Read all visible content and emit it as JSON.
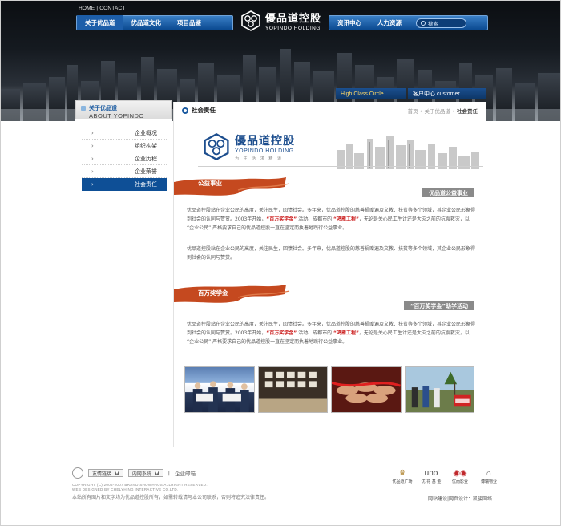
{
  "topnav": {
    "home": "HOME",
    "sep": "|",
    "contact": "CONTACT"
  },
  "nav_left": [
    "关于优品道",
    "优品道文化",
    "项目品鉴"
  ],
  "nav_right": [
    "资讯中心",
    "人力资源"
  ],
  "search": {
    "placeholder": "搜索"
  },
  "logo": {
    "cn": "優品道控股",
    "en": "YOPINDO HOLDING"
  },
  "tabs": {
    "high_class": "High Class Circle",
    "customer": "客户中心 customer"
  },
  "sidebar": {
    "heading_cn": "关于优品道",
    "heading_en": "ABOUT YOPINDO",
    "items": [
      {
        "label": "企业概况"
      },
      {
        "label": "组织构架"
      },
      {
        "label": "企业历程"
      },
      {
        "label": "企业荣誉"
      },
      {
        "label": "社会责任",
        "active": true
      }
    ]
  },
  "main": {
    "title": "社会责任",
    "breadcrumb": {
      "home": "首页",
      "sep1": " • ",
      "parent": "关于优品道",
      "sep2": " • ",
      "current": "社会责任"
    },
    "banner": {
      "cn": "優品道控股",
      "en": "YOPINDO HOLDING",
      "slogan": "为 生 活 求 精 道"
    },
    "section1": {
      "ribbon": "公益事业",
      "tab": "优品道公益事业",
      "p1_a": "优品道控股站在企业公民的高度，关注民生，回馈社会。多年来，优品道控股的慈善捐赠遍及文教、扶贫等多个领域，其企业公民形象得到社会的认同与赞赏。2003年开始，",
      "p1_hl1": "“百万奖学金”",
      "p1_b": " 活动、成都市的 ",
      "p1_hl2": "“鸿雁工程”",
      "p1_c": "，无论是关心民工生计还是大灾之前的抗震救灾，以 “企业公民” 严格要求自己的优品道控股一直在坚定而执着地践行公益事业。",
      "p2": "优品道控股站在企业公民的高度，关注民生，回馈社会。多年来，优品道控股的慈善捐赠遍及文教、扶贫等多个领域，其企业公民形象得到社会的认同与赞赏。"
    },
    "section2": {
      "ribbon": "百万奖学金",
      "tab": "“百万奖学金”助学活动",
      "p1_a": "优品道控股站在企业公民的高度，关注民生，回馈社会。多年来，优品道控股的慈善捐赠遍及文教、扶贫等多个领域，其企业公民形象得到社会的认同与赞赏。2003年开始，",
      "p1_hl1": "“百万奖学金”",
      "p1_b": " 活动、成都市的 ",
      "p1_hl2": "“鸿雁工程”",
      "p1_c": "，无论是关心民工生计还是大灾之前的抗震救灾，以 “企业公民” 严格要求自己的优品道控股一直在坚定而执着地践行公益事业。"
    }
  },
  "footer": {
    "links_select": "友情链接",
    "intranet": "内网系统",
    "mail_sep": "|",
    "mail": "企业邮箱",
    "copyright_en1": "COPYRIGHT (C) 2006-2007 BRAND SHOWHAUS ALLRIGHT RESERVED.",
    "copyright_en2": "WEB DESIGNED BY CHELYHING INTERACTIVE CO.LTD.",
    "copyright_cn": "本站所有图片和文字均为优品道控股所有，如需转载请与本公司联系，否则将追究法律责任。",
    "partners": [
      "优品道广场",
      "优 花 基 金",
      "优而影业",
      "博瑞物业"
    ],
    "partner_marks": [
      "♛",
      "uno",
      "◉◉",
      "⌂"
    ],
    "credit": "网站建设|网页设计：凯骏网络"
  }
}
